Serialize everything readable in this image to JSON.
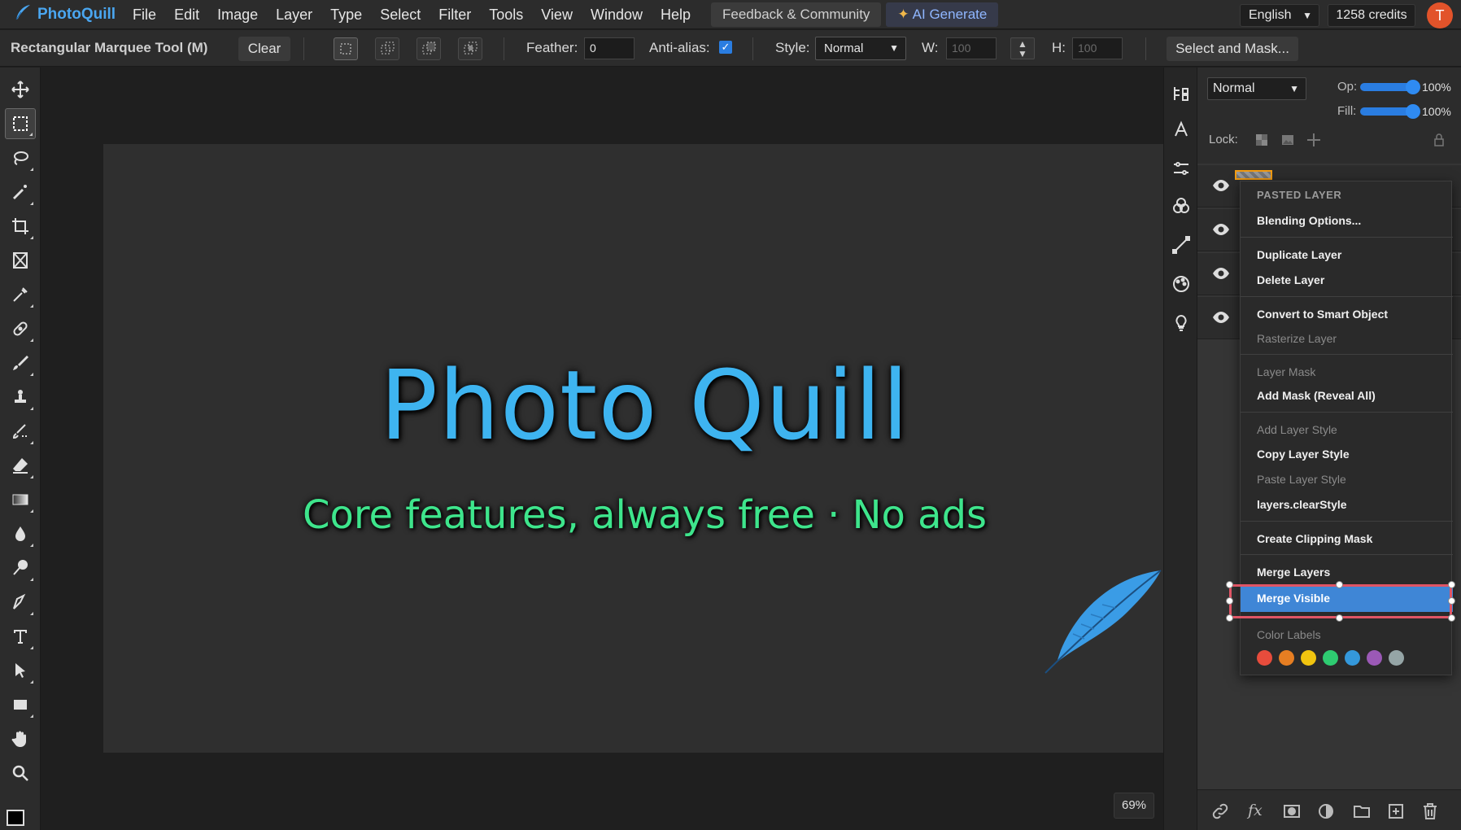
{
  "app": {
    "name": "PhotoQuill"
  },
  "menu": [
    "File",
    "Edit",
    "Image",
    "Layer",
    "Type",
    "Select",
    "Filter",
    "Tools",
    "View",
    "Window",
    "Help"
  ],
  "topbar": {
    "feedback": "Feedback & Community",
    "ai": "AI Generate",
    "language": "English",
    "credits": "1258 credits",
    "avatar_initial": "T",
    "avatar_color": "#e2532a"
  },
  "options": {
    "tool_name": "Rectangular Marquee Tool (M)",
    "clear": "Clear",
    "feather_label": "Feather:",
    "feather_value": "0",
    "antialias_label": "Anti-alias:",
    "antialias_checked": true,
    "style_label": "Style:",
    "style_value": "Normal",
    "w_label": "W:",
    "w_placeholder": "100",
    "h_label": "H:",
    "h_placeholder": "100",
    "select_mask": "Select and Mask..."
  },
  "tools": [
    "move-tool",
    "rectangular-marquee-tool",
    "lasso-tool",
    "magic-wand-tool",
    "crop-tool",
    "frame-tool",
    "eyedropper-tool",
    "spot-healing-tool",
    "brush-tool",
    "clone-stamp-tool",
    "history-brush-tool",
    "eraser-tool",
    "gradient-tool",
    "blur-tool",
    "dodge-tool",
    "pen-tool",
    "type-tool",
    "path-selection-tool",
    "rectangle-tool",
    "hand-tool",
    "zoom-tool"
  ],
  "canvas": {
    "title": "Photo Quill",
    "subtitle": "Core features, always free · No ads",
    "title_color": "#3eb4f0",
    "subtitle_color": "#3ee58c",
    "zoom": "69%"
  },
  "layers_panel": {
    "blend_mode": "Normal",
    "opacity_label": "Op:",
    "opacity": "100%",
    "fill_label": "Fill:",
    "fill": "100%",
    "lock_label": "Lock:"
  },
  "context_menu": {
    "header": "PASTED LAYER",
    "blending_options": "Blending Options...",
    "duplicate": "Duplicate Layer",
    "delete": "Delete Layer",
    "convert_smart": "Convert to Smart Object",
    "rasterize": "Rasterize Layer",
    "layer_mask": "Layer Mask",
    "add_mask": "Add Mask (Reveal All)",
    "add_style": "Add Layer Style",
    "copy_style": "Copy Layer Style",
    "paste_style": "Paste Layer Style",
    "clear_style": "layers.clearStyle",
    "clipping_mask": "Create Clipping Mask",
    "merge_layers": "Merge Layers",
    "merge_visible": "Merge Visible",
    "color_labels": "Color Labels",
    "label_colors": [
      "#e74c3c",
      "#e67e22",
      "#f1c40f",
      "#2ecc71",
      "#3498db",
      "#9b59b6",
      "#95a5a6"
    ]
  }
}
